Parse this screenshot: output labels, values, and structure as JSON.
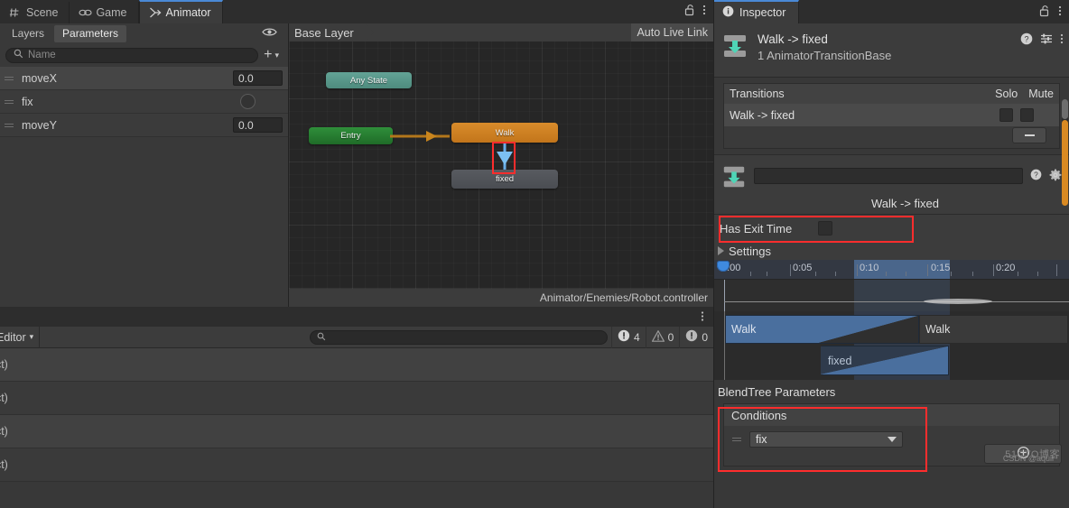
{
  "animator_window": {
    "tabs": [
      {
        "label": "Scene",
        "icon": "grid-icon",
        "active": false
      },
      {
        "label": "Game",
        "icon": "gamepad-icon",
        "active": false
      },
      {
        "label": "Animator",
        "icon": "animator-icon",
        "active": true
      }
    ],
    "lock_icon": "lock-open-icon",
    "menu_icon": "kebab-menu-icon",
    "parameters_panel": {
      "subtabs": [
        {
          "label": "Layers",
          "selected": false
        },
        {
          "label": "Parameters",
          "selected": true
        }
      ],
      "eye_icon": "eye-icon",
      "search": {
        "placeholder": "Name",
        "value": "",
        "icon": "search-icon"
      },
      "add_label": "+",
      "add_caret": "▾",
      "items": [
        {
          "name": "moveX",
          "type": "float",
          "value": "0.0"
        },
        {
          "name": "fix",
          "type": "bool",
          "value": ""
        },
        {
          "name": "moveY",
          "type": "float",
          "value": "0.0"
        }
      ]
    },
    "graph": {
      "breadcrumb": "Base Layer",
      "live_link": "Auto Live Link",
      "nodes": [
        {
          "id": "any",
          "label": "Any State"
        },
        {
          "id": "entry",
          "label": "Entry"
        },
        {
          "id": "walk",
          "label": "Walk"
        },
        {
          "id": "fixed",
          "label": "fixed"
        }
      ],
      "footer_path": "Animator/Enemies/Robot.controller"
    }
  },
  "console_window": {
    "menu_icon": "kebab-menu-icon",
    "filter_label": "Editor",
    "filter_caret": "▾",
    "search": {
      "placeholder": "",
      "value": "",
      "icon": "search-icon"
    },
    "counters": [
      {
        "icon": "error-icon",
        "count": "4"
      },
      {
        "icon": "warning-icon",
        "count": "0"
      },
      {
        "icon": "info-icon",
        "count": "0"
      }
    ],
    "rows": [
      {
        "text": "ect)"
      },
      {
        "text": "ect)"
      },
      {
        "text": "ect)"
      },
      {
        "text": "ect)"
      }
    ]
  },
  "inspector": {
    "tab": {
      "label": "Inspector",
      "icon": "info-icon"
    },
    "lock_icon": "lock-open-icon",
    "menu_icon": "kebab-menu-icon",
    "header": {
      "icon": "transition-icon",
      "title": "Walk -> fixed",
      "subtitle": "1 AnimatorTransitionBase",
      "help_icon": "help-icon",
      "preset_icon": "preset-icon",
      "kebab_icon": "kebab-menu-icon"
    },
    "transitions": {
      "header_label": "Transitions",
      "solo_label": "Solo",
      "mute_label": "Mute",
      "items": [
        {
          "label": "Walk -> fixed",
          "solo": false,
          "mute": false
        }
      ],
      "remove_label": "−"
    },
    "detail": {
      "icon": "transition-icon",
      "name_value": "",
      "help_icon": "help-icon",
      "gear_icon": "gear-icon",
      "title": "Walk -> fixed",
      "has_exit_time_label": "Has Exit Time",
      "has_exit_time_checked": false,
      "settings_label": "Settings",
      "settings_expanded": false
    },
    "timeline": {
      "ticks": [
        {
          "label": "0:00",
          "pos_pct": 0.0
        },
        {
          "label": "0:05",
          "pos_pct": 22.0
        },
        {
          "label": "0:10",
          "pos_pct": 48.5
        },
        {
          "label": "0:15",
          "pos_pct": 76.0
        },
        {
          "label": "0:20",
          "pos_pct": 100.0
        }
      ],
      "selection_start_pct": 30.5,
      "selection_end_pct": 57.0,
      "playhead_pct": 0.0,
      "tracks": [
        {
          "name": "Walk",
          "start_pct": 0.0,
          "end_pct": 57.0,
          "style": "source"
        },
        {
          "name": "Walk",
          "start_pct": 72.5,
          "end_pct": 100.0,
          "style": "tail"
        },
        {
          "name": "fixed",
          "start_pct": 30.5,
          "end_pct": 74.0,
          "style": "dest"
        }
      ]
    },
    "blendtree_label": "BlendTree Parameters",
    "conditions": {
      "header_label": "Conditions",
      "items": [
        {
          "parameter": "fix",
          "caret": "▾"
        }
      ],
      "add_icon": "plus-circle-icon"
    },
    "watermark": "51CTO博客",
    "watermark2": "CSDN @aquir"
  }
}
